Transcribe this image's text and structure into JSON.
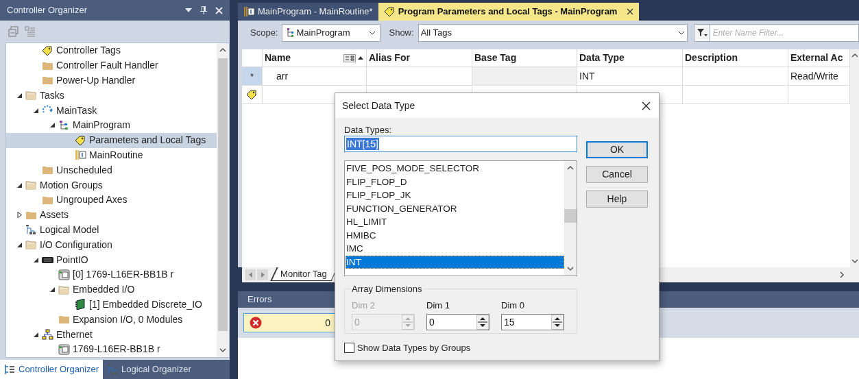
{
  "organizer": {
    "title": "Controller Organizer",
    "tree": [
      {
        "children": [
          {
            "label": "Controller Tags",
            "kind": "tag",
            "selected": false
          },
          {
            "label": "Controller Fault Handler",
            "kind": "folder",
            "selected": false
          },
          {
            "label": "Power-Up Handler",
            "kind": "folder",
            "selected": false
          }
        ]
      },
      {
        "label": "Tasks",
        "kind": "open-folder",
        "selected": false,
        "expanded": true,
        "children": [
          {
            "label": "MainTask",
            "kind": "task",
            "selected": false,
            "expanded": true,
            "children": [
              {
                "label": "MainProgram",
                "kind": "program",
                "selected": false,
                "expanded": true,
                "children": [
                  {
                    "label": "Parameters and Local Tags",
                    "kind": "tag",
                    "selected": true
                  },
                  {
                    "label": "MainRoutine",
                    "kind": "routine",
                    "selected": false
                  }
                ]
              }
            ]
          },
          {
            "label": "Unscheduled",
            "kind": "folder",
            "selected": false
          }
        ]
      },
      {
        "label": "Motion Groups",
        "kind": "open-folder",
        "selected": false,
        "expanded": true,
        "children": [
          {
            "label": "Ungrouped Axes",
            "kind": "folder",
            "selected": false
          }
        ]
      },
      {
        "label": "Assets",
        "kind": "folder",
        "selected": false,
        "expanded": false
      },
      {
        "label": "Logical Model",
        "kind": "model",
        "selected": false
      },
      {
        "label": "I/O Configuration",
        "kind": "open-folder",
        "selected": false,
        "expanded": true,
        "children": [
          {
            "label": "PointIO",
            "kind": "chassis",
            "selected": false,
            "expanded": true,
            "children": [
              {
                "label": "[0] 1769-L16ER-BB1B r",
                "kind": "module",
                "selected": false
              },
              {
                "label": "Embedded I/O",
                "kind": "open-folder",
                "selected": false,
                "expanded": true,
                "children": [
                  {
                    "label": "[1] Embedded Discrete_IO",
                    "kind": "card",
                    "selected": false
                  }
                ]
              },
              {
                "label": "Expansion I/O, 0 Modules",
                "kind": "folder",
                "selected": false
              }
            ]
          },
          {
            "label": "Ethernet",
            "kind": "network",
            "selected": false,
            "expanded": true,
            "children": [
              {
                "label": "1769-L16ER-BB1B r",
                "kind": "module",
                "selected": false
              }
            ]
          }
        ]
      }
    ],
    "bottom_tabs": [
      {
        "label": "Controller Organizer",
        "kind": "tree",
        "selected": true
      },
      {
        "label": "Logical Organizer",
        "kind": "model",
        "selected": false
      }
    ]
  },
  "editor": {
    "tabs": [
      {
        "label": "MainProgram - MainRoutine*",
        "kind": "routine",
        "selected": false
      },
      {
        "label": "Program Parameters and Local Tags - MainProgram",
        "kind": "tag",
        "selected": true
      }
    ],
    "scope": {
      "label": "Scope:",
      "value": "MainProgram"
    },
    "show": {
      "label": "Show:",
      "value": "All Tags"
    },
    "filter": {
      "placeholder": "Enter Name Filter..."
    },
    "table": {
      "columns": [
        "Name",
        "Alias For",
        "Base Tag",
        "Data Type",
        "Description",
        "External Ac"
      ],
      "rows": [
        {
          "kind": "tag",
          "marker": "*",
          "name": "arr",
          "data_type": "INT",
          "external_access": "Read/Write"
        },
        {
          "kind": "new"
        }
      ]
    },
    "sheet_tabs": [
      "Monitor Tag"
    ]
  },
  "errors": {
    "title": "Errors",
    "count": "0"
  },
  "dialog": {
    "title": "Select Data Type",
    "field_label": "Data Types:",
    "value": "INT[15]",
    "buttons": [
      {
        "label": "OK",
        "default": true
      },
      {
        "label": "Cancel",
        "default": false
      },
      {
        "label": "Help",
        "default": false
      }
    ],
    "types": [
      {
        "label": "FIVE_POS_MODE_SELECTOR",
        "selected": false
      },
      {
        "label": "FLIP_FLOP_D",
        "selected": false
      },
      {
        "label": "FLIP_FLOP_JK",
        "selected": false
      },
      {
        "label": "FUNCTION_GENERATOR",
        "selected": false
      },
      {
        "label": "HL_LIMIT",
        "selected": false
      },
      {
        "label": "HMIBC",
        "selected": false
      },
      {
        "label": "IMC",
        "selected": false
      },
      {
        "label": "INT",
        "selected": true
      }
    ],
    "array_dimensions": {
      "title": "Array Dimensions",
      "dims": [
        {
          "label": "Dim 2",
          "value": "0",
          "disabled": true
        },
        {
          "label": "Dim 1",
          "value": "0",
          "disabled": false
        },
        {
          "label": "Dim 0",
          "value": "15",
          "disabled": false
        }
      ]
    },
    "group_checkbox": {
      "label": "Show Data Types by Groups",
      "checked": false
    }
  }
}
